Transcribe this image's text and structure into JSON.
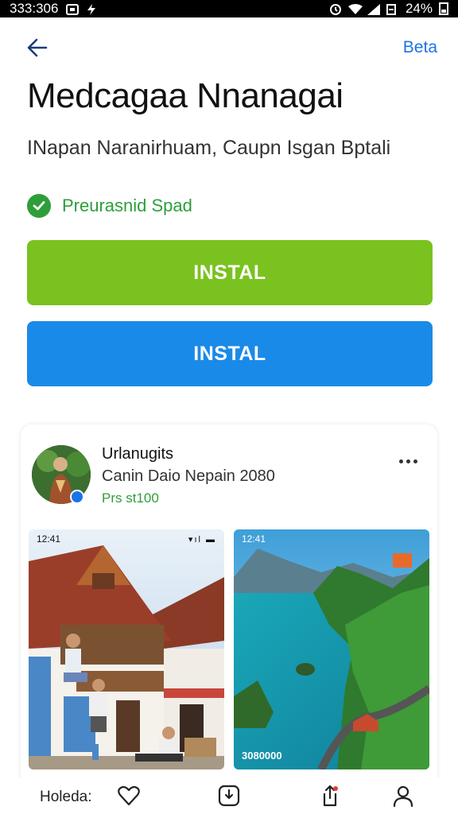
{
  "status_bar": {
    "time": "333:306",
    "battery": "24%",
    "icons": [
      "screenshot-icon",
      "flash-icon",
      "alarm-icon",
      "wifi-icon",
      "signal-icon",
      "battery-icon"
    ]
  },
  "nav": {
    "action_label": "Beta"
  },
  "app": {
    "title": "Medcagaa Nnanagai",
    "subtitle": "INapan Naranirhuam, Caupn Isgan Bptali",
    "verified_label": "Preurasnid Spad"
  },
  "buttons": {
    "install_green": "INSTAL",
    "install_blue": "INSTAL"
  },
  "developer": {
    "name": "Urlanugits",
    "meta": "Canin Daio Nepain 2080",
    "price": "Prs st100"
  },
  "screenshots": [
    {
      "status_time": "12:41",
      "status_icons": "▾ıl ▬"
    },
    {
      "status_time": "12:41",
      "caption": "3080000"
    }
  ],
  "bottom_bar": {
    "label": "Holeda:"
  },
  "colors": {
    "accent_blue": "#1a8ae8",
    "accent_green": "#7ac21f",
    "verified_green": "#2e9e3a"
  }
}
